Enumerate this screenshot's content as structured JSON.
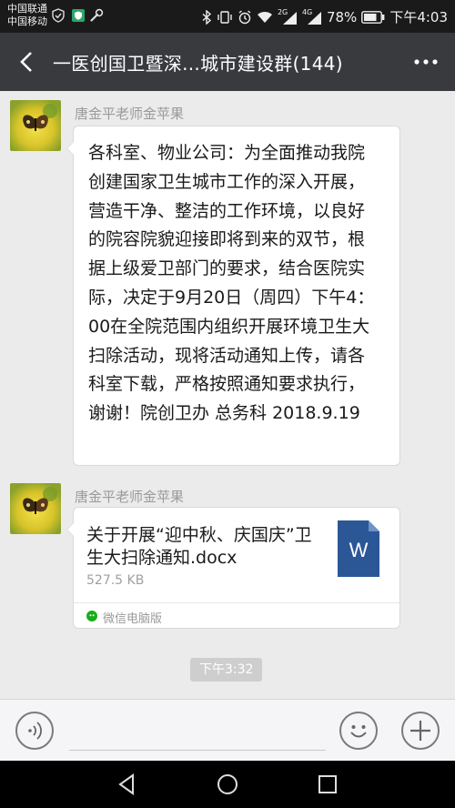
{
  "status_bar": {
    "carrier_1": "中国联通",
    "carrier_2": "中国移动",
    "network_2g": "2G",
    "network_4g": "4G",
    "battery": "78%",
    "time": "下午4:03"
  },
  "header": {
    "title": "一医创国卫暨深...城市建设群(144)"
  },
  "messages": [
    {
      "sender": "唐金平老师金苹果",
      "text": "各科室、物业公司：为全面推动我院创建国家卫生城市工作的深入开展，营造干净、整洁的工作环境，以良好的院容院貌迎接即将到来的双节，根据上级爱卫部门的要求，结合医院实际，决定于9月20日（周四）下午4：00在全院范围内组织开展环境卫生大扫除活动，现将活动通知上传，请各科室下载，严格按照通知要求执行，谢谢！院创卫办 总务科 2018.9.19"
    },
    {
      "sender": "唐金平老师金苹果",
      "file": {
        "name": "关于开展“迎中秋、庆国庆”卫生大扫除通知.docx",
        "size": "527.5 KB",
        "icon_letter": "W",
        "source": "微信电脑版"
      }
    }
  ],
  "timestamp": "下午3:32",
  "colors": {
    "header_bg": "#393a3e",
    "word_blue": "#2b5797",
    "status_bg": "#1a1a1a"
  },
  "icons": [
    "back-arrow-icon",
    "more-icon",
    "voice-icon",
    "emoji-icon",
    "plus-icon",
    "nav-back-icon",
    "nav-home-icon",
    "nav-recents-icon"
  ]
}
